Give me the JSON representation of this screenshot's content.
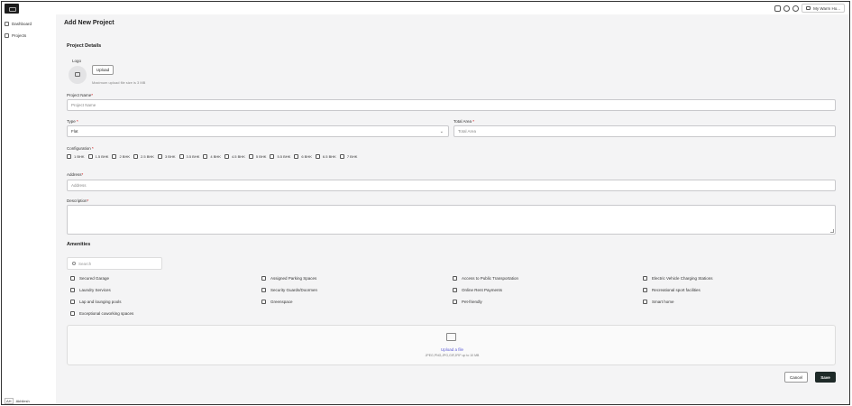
{
  "topbar": {
    "user_label": "My Warm Ho..."
  },
  "sidebar": {
    "items": [
      {
        "label": "Dashboard",
        "icon": "chart-icon"
      },
      {
        "label": "Projects",
        "icon": "document-icon"
      }
    ],
    "footer": {
      "tag": "AH",
      "label": "Akhilesh"
    }
  },
  "page": {
    "title": "Add New Project"
  },
  "project_details": {
    "title": "Project Details",
    "logo_label": "Logo",
    "upload_label": "Upload",
    "upload_hint": "Maximum upload file size is 3 MB",
    "project_name_label": "Project Name",
    "project_name_placeholder": "Project Name",
    "type_label": "Type",
    "type_value": "Flat",
    "total_area_label": "Total Area",
    "total_area_placeholder": "Total Area",
    "configuration_label": "Configuration",
    "configurations": [
      "1 BHK",
      "1.5 BHK",
      "2 BHK",
      "2.5 BHK",
      "3 BHK",
      "3.5 BHK",
      "4 BHK",
      "4.5 BHK",
      "5 BHK",
      "5.5 BHK",
      "6 BHK",
      "6.5 BHK",
      "7 BHK"
    ],
    "address_label": "Address",
    "address_placeholder": "Address",
    "description_label": "Description"
  },
  "amenities": {
    "title": "Amenities",
    "search_placeholder": "Search",
    "items": [
      "Secured Garage",
      "Assigned Parking Spaces",
      "Access to Public Transportation",
      "Electric Vehicle Charging Stations",
      "Laundry Services",
      "Security Guards/Doormen",
      "Online Rent Payments",
      "Recreational sport facilities",
      "Lap and lounging pools",
      "Greenspace",
      "Pet-friendly",
      "Smart home",
      "Exceptional coworking spaces"
    ]
  },
  "dropzone": {
    "link": "Upload a file",
    "hint": "JPEG,PNG,JPG,GIF,JFIF up to 10 MB"
  },
  "actions": {
    "cancel": "Cancel",
    "save": "Save"
  }
}
